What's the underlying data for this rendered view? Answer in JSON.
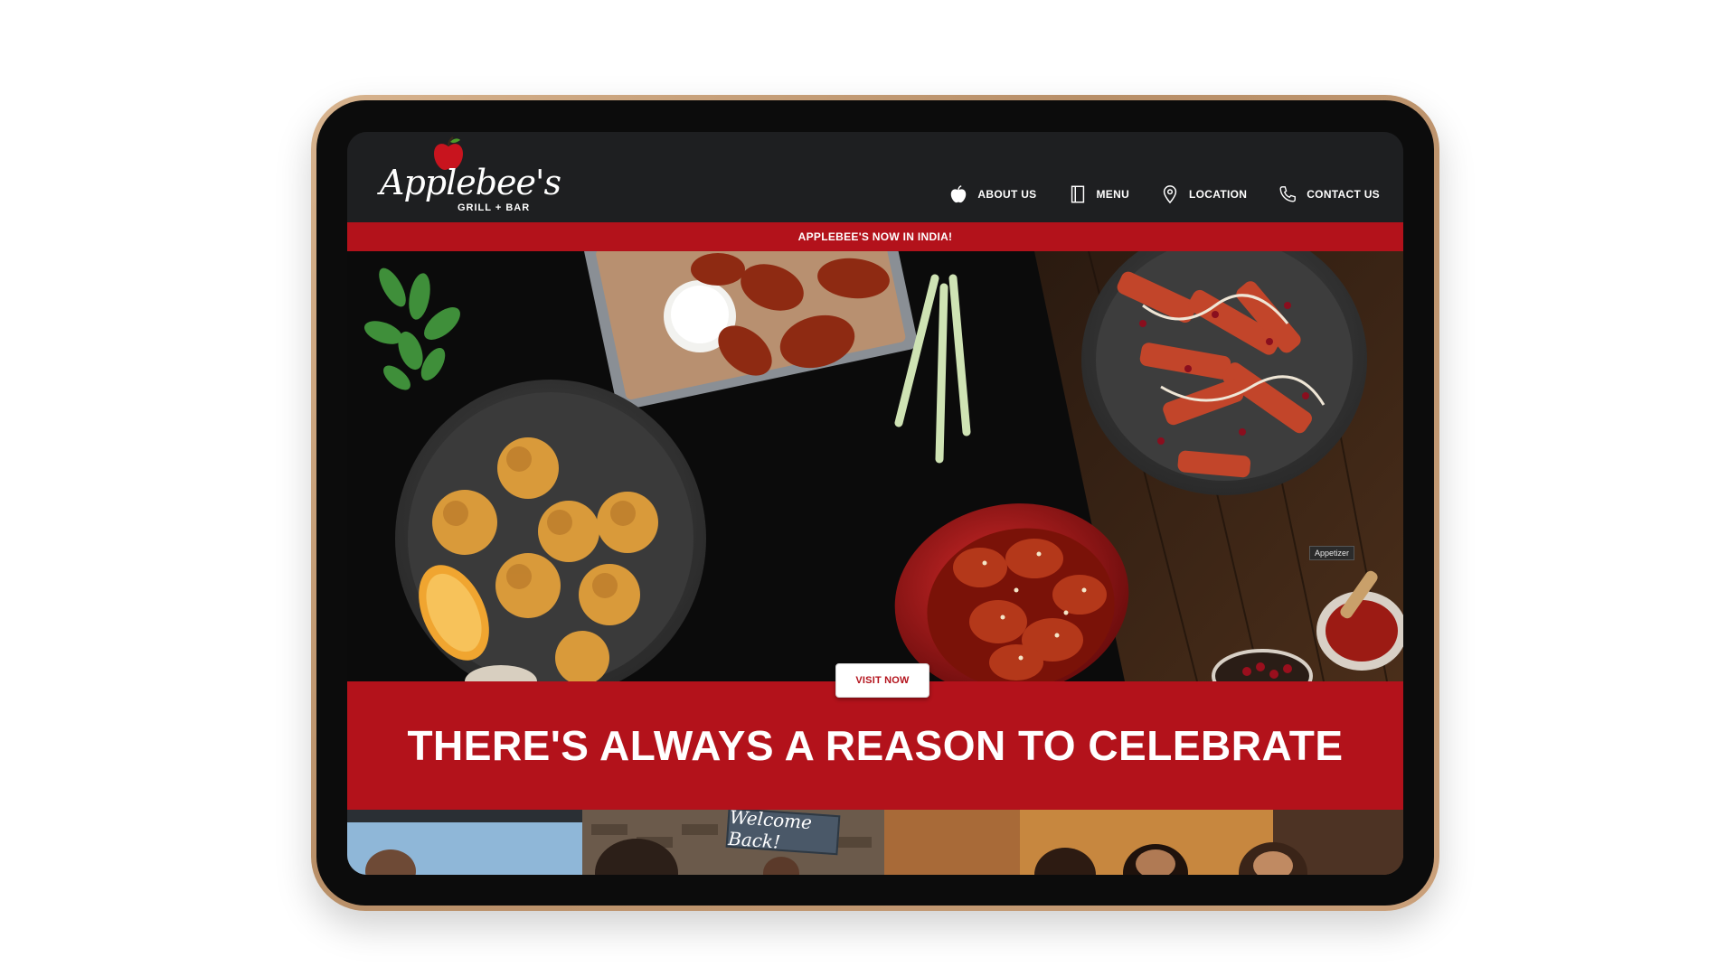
{
  "brand": {
    "name": "Applebee's",
    "tagline": "GRILL + BAR",
    "accent_red": "#b3121b",
    "header_bg": "#1e1f21"
  },
  "nav": {
    "items": [
      {
        "label": "ABOUT US",
        "icon": "apple-icon"
      },
      {
        "label": "MENU",
        "icon": "book-icon"
      },
      {
        "label": "LOCATION",
        "icon": "map-pin-icon"
      },
      {
        "label": "CONTACT US",
        "icon": "phone-icon"
      }
    ]
  },
  "announcement": {
    "text": "APPLEBEE'S NOW IN INDIA!"
  },
  "hero": {
    "tag": "Appetizer",
    "cta_label": "VISIT NOW"
  },
  "banner": {
    "headline": "THERE'S ALWAYS A REASON TO CELEBRATE"
  },
  "strip": {
    "sign_text": "Welcome Back!"
  }
}
